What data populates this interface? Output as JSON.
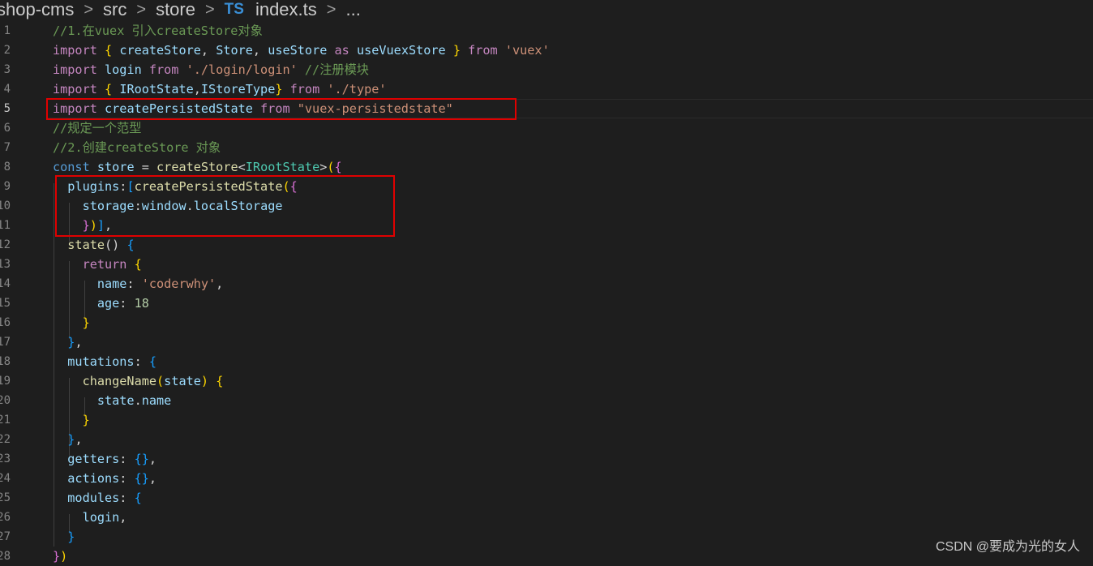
{
  "breadcrumb": {
    "items": [
      "shop-cms",
      "src",
      "store",
      "index.ts",
      "..."
    ],
    "separator": ">",
    "file_icon_text": "TS"
  },
  "editor": {
    "active_line": 5,
    "lines": [
      {
        "n": "1",
        "tokens": [
          {
            "t": "//1.在vuex 引入createStore对象",
            "c": "cm"
          }
        ]
      },
      {
        "n": "2",
        "tokens": [
          {
            "t": "import ",
            "c": "kw"
          },
          {
            "t": "{ ",
            "c": "b1"
          },
          {
            "t": "createStore",
            "c": "var"
          },
          {
            "t": ", ",
            "c": "p"
          },
          {
            "t": "Store",
            "c": "var"
          },
          {
            "t": ", ",
            "c": "p"
          },
          {
            "t": "useStore",
            "c": "var"
          },
          {
            "t": " as ",
            "c": "kw"
          },
          {
            "t": "useVuexStore",
            "c": "var"
          },
          {
            "t": " }",
            "c": "b1"
          },
          {
            "t": " from ",
            "c": "kw"
          },
          {
            "t": "'vuex'",
            "c": "str"
          }
        ]
      },
      {
        "n": "3",
        "tokens": [
          {
            "t": "import ",
            "c": "kw"
          },
          {
            "t": "login",
            "c": "var"
          },
          {
            "t": " from ",
            "c": "kw"
          },
          {
            "t": "'./login/login'",
            "c": "str"
          },
          {
            "t": " //注册模块",
            "c": "cm"
          }
        ]
      },
      {
        "n": "4",
        "tokens": [
          {
            "t": "import ",
            "c": "kw"
          },
          {
            "t": "{ ",
            "c": "b1"
          },
          {
            "t": "IRootState",
            "c": "var"
          },
          {
            "t": ",",
            "c": "p"
          },
          {
            "t": "IStoreType",
            "c": "var"
          },
          {
            "t": "}",
            "c": "b1"
          },
          {
            "t": " from ",
            "c": "kw"
          },
          {
            "t": "'./type'",
            "c": "str"
          }
        ]
      },
      {
        "n": "5",
        "tokens": [
          {
            "t": "import ",
            "c": "kw"
          },
          {
            "t": "createPersistedState",
            "c": "var"
          },
          {
            "t": " from ",
            "c": "kw"
          },
          {
            "t": "\"vuex-persistedstate\"",
            "c": "str"
          }
        ]
      },
      {
        "n": "6",
        "tokens": [
          {
            "t": "//规定一个范型",
            "c": "cm"
          }
        ]
      },
      {
        "n": "7",
        "tokens": [
          {
            "t": "//2.创建createStore 对象",
            "c": "cm"
          }
        ]
      },
      {
        "n": "8",
        "tokens": [
          {
            "t": "const ",
            "c": "decl"
          },
          {
            "t": "store",
            "c": "var"
          },
          {
            "t": " = ",
            "c": "p"
          },
          {
            "t": "createStore",
            "c": "fn"
          },
          {
            "t": "<",
            "c": "p"
          },
          {
            "t": "IRootState",
            "c": "type"
          },
          {
            "t": ">",
            "c": "p"
          },
          {
            "t": "(",
            "c": "b1"
          },
          {
            "t": "{",
            "c": "b2"
          }
        ]
      },
      {
        "n": "9",
        "tokens": [
          {
            "t": "  plugins",
            "c": "var"
          },
          {
            "t": ":",
            "c": "p"
          },
          {
            "t": "[",
            "c": "b3"
          },
          {
            "t": "createPersistedState",
            "c": "fn"
          },
          {
            "t": "(",
            "c": "b1"
          },
          {
            "t": "{",
            "c": "b2"
          }
        ]
      },
      {
        "n": "10",
        "tokens": [
          {
            "t": "    storage",
            "c": "var"
          },
          {
            "t": ":",
            "c": "p"
          },
          {
            "t": "window",
            "c": "var"
          },
          {
            "t": ".",
            "c": "p"
          },
          {
            "t": "localStorage",
            "c": "var"
          }
        ]
      },
      {
        "n": "11",
        "tokens": [
          {
            "t": "    }",
            "c": "b2"
          },
          {
            "t": ")",
            "c": "b1"
          },
          {
            "t": "]",
            "c": "b3"
          },
          {
            "t": ",",
            "c": "p"
          }
        ]
      },
      {
        "n": "12",
        "tokens": [
          {
            "t": "  state",
            "c": "fn"
          },
          {
            "t": "() ",
            "c": "p"
          },
          {
            "t": "{",
            "c": "b3"
          }
        ]
      },
      {
        "n": "13",
        "tokens": [
          {
            "t": "    return ",
            "c": "kw"
          },
          {
            "t": "{",
            "c": "b1"
          }
        ]
      },
      {
        "n": "14",
        "tokens": [
          {
            "t": "      name",
            "c": "var"
          },
          {
            "t": ": ",
            "c": "p"
          },
          {
            "t": "'coderwhy'",
            "c": "str"
          },
          {
            "t": ",",
            "c": "p"
          }
        ]
      },
      {
        "n": "15",
        "tokens": [
          {
            "t": "      age",
            "c": "var"
          },
          {
            "t": ": ",
            "c": "p"
          },
          {
            "t": "18",
            "c": "num"
          }
        ]
      },
      {
        "n": "16",
        "tokens": [
          {
            "t": "    }",
            "c": "b1"
          }
        ]
      },
      {
        "n": "17",
        "tokens": [
          {
            "t": "  }",
            "c": "b3"
          },
          {
            "t": ",",
            "c": "p"
          }
        ]
      },
      {
        "n": "18",
        "tokens": [
          {
            "t": "  mutations",
            "c": "var"
          },
          {
            "t": ": ",
            "c": "p"
          },
          {
            "t": "{",
            "c": "b3"
          }
        ]
      },
      {
        "n": "19",
        "tokens": [
          {
            "t": "    changeName",
            "c": "fn"
          },
          {
            "t": "(",
            "c": "b1"
          },
          {
            "t": "state",
            "c": "var"
          },
          {
            "t": ") ",
            "c": "b1"
          },
          {
            "t": "{",
            "c": "b1"
          }
        ]
      },
      {
        "n": "20",
        "tokens": [
          {
            "t": "      state",
            "c": "var"
          },
          {
            "t": ".",
            "c": "p"
          },
          {
            "t": "name",
            "c": "var"
          }
        ]
      },
      {
        "n": "21",
        "tokens": [
          {
            "t": "    }",
            "c": "b1"
          }
        ]
      },
      {
        "n": "22",
        "tokens": [
          {
            "t": "  }",
            "c": "b3"
          },
          {
            "t": ",",
            "c": "p"
          }
        ]
      },
      {
        "n": "23",
        "tokens": [
          {
            "t": "  getters",
            "c": "var"
          },
          {
            "t": ": ",
            "c": "p"
          },
          {
            "t": "{}",
            "c": "b3"
          },
          {
            "t": ",",
            "c": "p"
          }
        ]
      },
      {
        "n": "24",
        "tokens": [
          {
            "t": "  actions",
            "c": "var"
          },
          {
            "t": ": ",
            "c": "p"
          },
          {
            "t": "{}",
            "c": "b3"
          },
          {
            "t": ",",
            "c": "p"
          }
        ]
      },
      {
        "n": "25",
        "tokens": [
          {
            "t": "  modules",
            "c": "var"
          },
          {
            "t": ": ",
            "c": "p"
          },
          {
            "t": "{",
            "c": "b3"
          }
        ]
      },
      {
        "n": "26",
        "tokens": [
          {
            "t": "    login",
            "c": "var"
          },
          {
            "t": ",",
            "c": "p"
          }
        ]
      },
      {
        "n": "27",
        "tokens": [
          {
            "t": "  }",
            "c": "b3"
          }
        ]
      },
      {
        "n": "28",
        "tokens": [
          {
            "t": "}",
            "c": "b2"
          },
          {
            "t": ")",
            "c": "b1"
          }
        ]
      }
    ]
  },
  "annotations": {
    "box_color": "#e00000",
    "boxes": [
      {
        "label": "import-highlight",
        "lines": [
          5
        ]
      },
      {
        "label": "plugins-highlight",
        "lines": [
          9,
          10,
          11
        ]
      }
    ]
  },
  "watermark": "CSDN @要成为光的女人",
  "colors": {
    "background": "#1e1e1e",
    "keyword": "#c586c0",
    "variable": "#9cdcfe",
    "function": "#dcdcaa",
    "string": "#ce9178",
    "comment": "#6a9955",
    "number": "#b5cea8",
    "type": "#4ec9b0"
  }
}
